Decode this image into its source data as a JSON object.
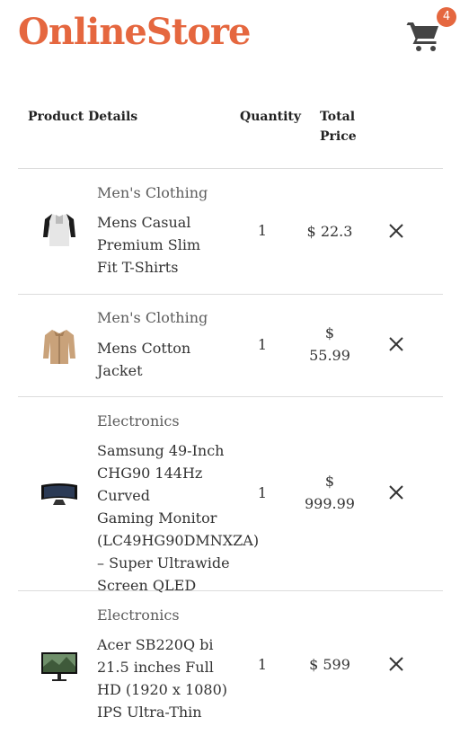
{
  "brand": {
    "name": "OnlineStore",
    "color": "#e5673f"
  },
  "cart": {
    "icon": "shopping-cart-icon",
    "count": "4"
  },
  "table_header": {
    "product": "Product Details",
    "quantity": "Quantity",
    "total_line1": "Total",
    "total_line2": "Price"
  },
  "items": [
    {
      "category": "Men's Clothing",
      "title_lines": [
        "Mens Casual",
        "Premium Slim",
        "Fit T-Shirts"
      ],
      "quantity": "1",
      "price_lines": [
        "$ 22.3"
      ],
      "image": "tshirt-image",
      "remove_icon": "close-icon"
    },
    {
      "category": "Men's Clothing",
      "title_lines": [
        "Mens Cotton",
        "Jacket"
      ],
      "quantity": "1",
      "price_lines": [
        "$",
        "55.99"
      ],
      "image": "jacket-image",
      "remove_icon": "close-icon"
    },
    {
      "category": "Electronics",
      "title_lines": [
        "Samsung 49-Inch",
        "CHG90 144Hz Curved",
        "Gaming Monitor",
        "(LC49HG90DMNXZA)",
        "– Super Ultrawide",
        "Screen QLED"
      ],
      "quantity": "1",
      "price_lines": [
        "$",
        "999.99"
      ],
      "image": "ultrawide-monitor-image",
      "remove_icon": "close-icon"
    },
    {
      "category": "Electronics",
      "title_lines": [
        "Acer SB220Q bi",
        "21.5 inches Full",
        "HD (1920 x 1080)",
        "IPS Ultra-Thin"
      ],
      "quantity": "1",
      "price_lines": [
        "$ 599"
      ],
      "image": "monitor-image",
      "remove_icon": "close-icon"
    }
  ]
}
